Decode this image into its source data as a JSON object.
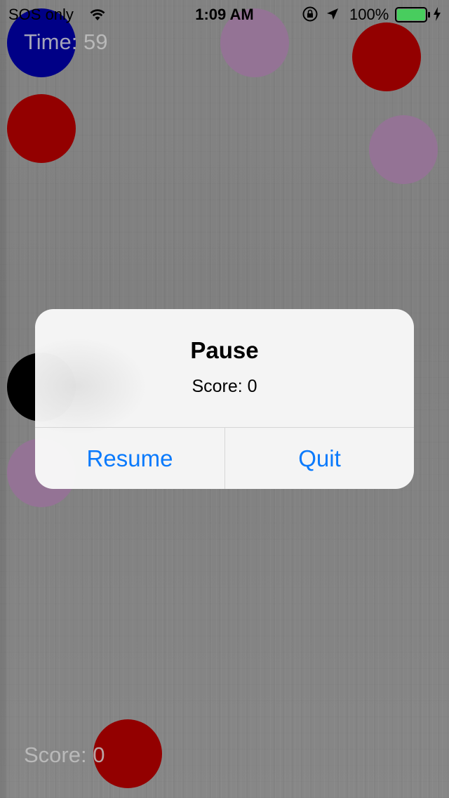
{
  "status_bar": {
    "carrier": "SOS only",
    "time": "1:09 AM",
    "battery_percent": "100%",
    "icons": [
      "wifi-icon",
      "rotation-lock-icon",
      "location-arrow-icon",
      "battery-icon",
      "charging-bolt-icon"
    ],
    "battery_fill_fraction": 1.0,
    "battery_color": "#4cd964"
  },
  "game": {
    "time_label": "Time:",
    "time_value": "59",
    "score_label": "Score:",
    "score_value": "0",
    "ball_colors": {
      "red": "#9b0000",
      "purple": "#9c7a9e",
      "blue": "#00008e",
      "black": "#000000"
    }
  },
  "alert": {
    "title": "Pause",
    "message": "Score: 0",
    "buttons": {
      "resume": "Resume",
      "quit": "Quit"
    },
    "button_color": "#0a7afc"
  }
}
